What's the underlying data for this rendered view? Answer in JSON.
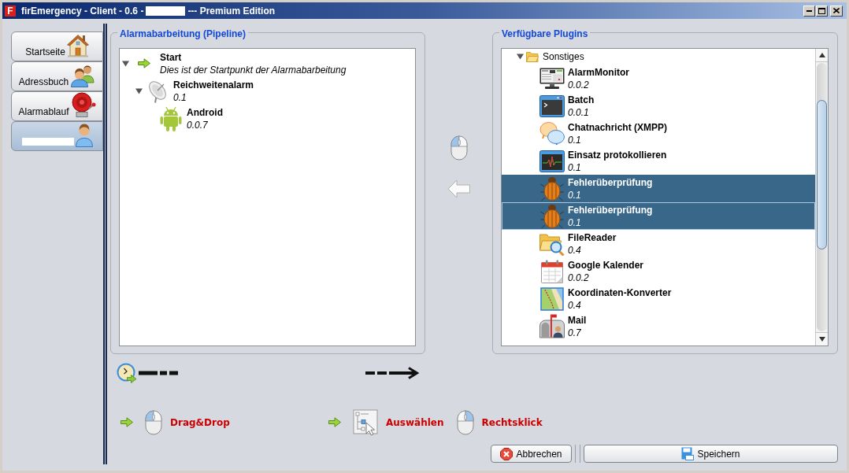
{
  "window": {
    "logo": "F",
    "title": "firEmergency - Client - 0.6 -",
    "redacted": true,
    "edition": "--- Premium Edition"
  },
  "sidebar": {
    "tabs": [
      {
        "kind": "home",
        "label": "Startseite",
        "redacted": false,
        "selected": false
      },
      {
        "kind": "contacts",
        "label": "Adressbuch",
        "redacted": false,
        "selected": false
      },
      {
        "kind": "alarm",
        "label": "Alarmablauf",
        "redacted": false,
        "selected": false
      },
      {
        "kind": "user",
        "redacted": true,
        "selected": true
      }
    ]
  },
  "pipeline": {
    "title": "Alarmabarbeitung (Pipeline)",
    "tree": [
      {
        "kind": "start",
        "name": "Start",
        "description": "Dies ist der Startpunkt der Alarmabarbeitung",
        "expanded": true,
        "children": [
          {
            "kind": "radar",
            "name": "Reichweitenalarm",
            "version": "0.1",
            "expanded": true,
            "children": [
              {
                "kind": "android",
                "name": "Android",
                "version": "0.0.7"
              }
            ]
          }
        ]
      }
    ]
  },
  "plugins": {
    "title": "Verfügbare Plugins",
    "tree": [
      {
        "kind": "folder",
        "name": "Sonstiges",
        "expanded": true,
        "selected": false,
        "focused": false,
        "children": [
          {
            "kind": "monitor",
            "name": "AlarmMonitor",
            "version": "0.0.2",
            "selected": false,
            "focused": false
          },
          {
            "kind": "terminal",
            "name": "Batch",
            "version": "0.0.1",
            "selected": false,
            "focused": false
          },
          {
            "kind": "chat",
            "name": "Chatnachricht (XMPP)",
            "version": "0.1",
            "selected": false,
            "focused": false
          },
          {
            "kind": "activity",
            "name": "Einsatz protokollieren",
            "version": "0.1",
            "selected": false,
            "focused": false
          },
          {
            "kind": "bug",
            "name": "Fehlerüberprüfung",
            "version": "0.1",
            "selected": true,
            "focused": false
          },
          {
            "kind": "bug",
            "name": "Fehlerüberprüfung",
            "version": "0.1",
            "selected": true,
            "focused": true
          },
          {
            "kind": "folder-search",
            "name": "FileReader",
            "version": "0.4",
            "selected": false,
            "focused": false
          },
          {
            "kind": "calendar",
            "name": "Google Kalender",
            "version": "0.0.2",
            "selected": false,
            "focused": false
          },
          {
            "kind": "map",
            "name": "Koordinaten-Konverter",
            "version": "0.4",
            "selected": false,
            "focused": false
          },
          {
            "kind": "mailbox",
            "name": "Mail",
            "version": "0.7",
            "selected": false,
            "focused": false
          }
        ]
      }
    ]
  },
  "legend": [
    {
      "kind": "left-click",
      "label": "Drag&Drop",
      "arrow": true
    },
    {
      "kind": "select",
      "label": "Auswählen",
      "arrow": true
    },
    {
      "kind": "right-click",
      "label": "Rechtsklick",
      "arrow": false
    }
  ],
  "buttons": [
    {
      "kind": "cancel",
      "label": "Abbrechen"
    },
    {
      "kind": "save",
      "label": "Speichern"
    }
  ]
}
